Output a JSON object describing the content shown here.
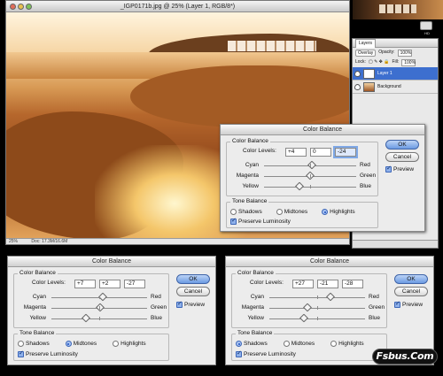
{
  "document": {
    "title": "_IGP0171b.jpg @ 25% (Layer 1, RGB/8*)",
    "status_zoom": "25%",
    "status_doc": "Doc: 17.3M/16.6M"
  },
  "desktop": {
    "drive_label": "HD"
  },
  "layers_panel": {
    "tab_label": "Layers",
    "blend_mode": "Overlay",
    "opacity_label": "Opacity:",
    "opacity_value": "100%",
    "lock_label": "Lock:",
    "fill_label": "Fill:",
    "fill_value": "100%",
    "layers": [
      {
        "name": "Layer 1",
        "active": true
      },
      {
        "name": "Background",
        "active": false
      }
    ]
  },
  "dialogs": [
    {
      "title": "Color Balance",
      "group_title": "Color Balance",
      "levels_label": "Color Levels:",
      "levels": [
        "+4",
        "0",
        "-24"
      ],
      "sliders": [
        {
          "left": "Cyan",
          "right": "Red",
          "value": 4
        },
        {
          "left": "Magenta",
          "right": "Green",
          "value": 0
        },
        {
          "left": "Yellow",
          "right": "Blue",
          "value": -24
        }
      ],
      "tone_title": "Tone Balance",
      "tones": [
        "Shadows",
        "Midtones",
        "Highlights"
      ],
      "tone_selected": "Highlights",
      "preserve_label": "Preserve Luminosity",
      "ok_label": "OK",
      "cancel_label": "Cancel",
      "preview_label": "Preview"
    },
    {
      "title": "Color Balance",
      "group_title": "Color Balance",
      "levels_label": "Color Levels:",
      "levels": [
        "+7",
        "+2",
        "-27"
      ],
      "sliders": [
        {
          "left": "Cyan",
          "right": "Red",
          "value": 7
        },
        {
          "left": "Magenta",
          "right": "Green",
          "value": 2
        },
        {
          "left": "Yellow",
          "right": "Blue",
          "value": -27
        }
      ],
      "tone_title": "Tone Balance",
      "tones": [
        "Shadows",
        "Midtones",
        "Highlights"
      ],
      "tone_selected": "Midtones",
      "preserve_label": "Preserve Luminosity",
      "ok_label": "OK",
      "cancel_label": "Cancel",
      "preview_label": "Preview"
    },
    {
      "title": "Color Balance",
      "group_title": "Color Balance",
      "levels_label": "Color Levels:",
      "levels": [
        "+27",
        "-21",
        "-28"
      ],
      "sliders": [
        {
          "left": "Cyan",
          "right": "Red",
          "value": 27
        },
        {
          "left": "Magenta",
          "right": "Green",
          "value": -21
        },
        {
          "left": "Yellow",
          "right": "Blue",
          "value": -28
        }
      ],
      "tone_title": "Tone Balance",
      "tones": [
        "Shadows",
        "Midtones",
        "Highlights"
      ],
      "tone_selected": "Shadows",
      "preserve_label": "Preserve Luminosity",
      "ok_label": "OK",
      "cancel_label": "Cancel",
      "preview_label": "Preview"
    }
  ],
  "watermark": "Fsbus.Com"
}
